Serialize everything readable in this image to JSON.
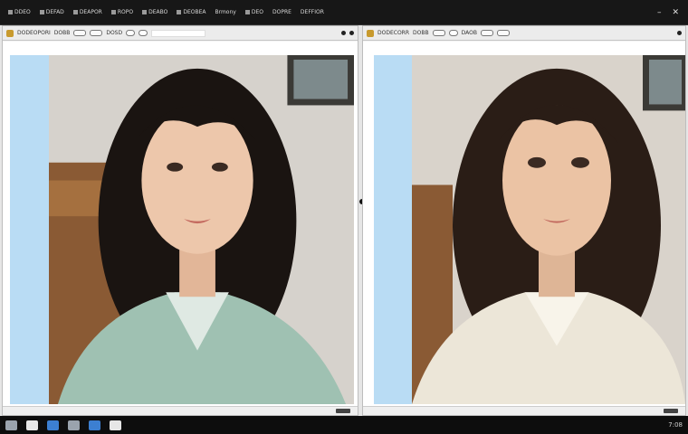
{
  "window": {
    "controls": [
      "–",
      "✕"
    ]
  },
  "menubar": {
    "items": [
      {
        "label": "DDEO",
        "icon": "file-icon"
      },
      {
        "label": "DEFAD",
        "icon": "edit-icon"
      },
      {
        "label": "DEAPOR",
        "icon": "view-icon"
      },
      {
        "label": "ROPO",
        "icon": "tools-icon"
      },
      {
        "label": "DEABO",
        "icon": "image-icon"
      },
      {
        "label": "DEOBEA",
        "icon": "window-icon"
      },
      {
        "label": "Brmony",
        "icon": "layers-icon"
      },
      {
        "label": "DEO",
        "icon": "filter-icon"
      },
      {
        "label": "DOPRE",
        "icon": "help-icon"
      },
      {
        "label": "DEFFIOR",
        "icon": "extras-icon"
      }
    ]
  },
  "panels": {
    "left": {
      "title": "DODEOPORI",
      "toolbar_labels": [
        "DOBB",
        "DOSD"
      ]
    },
    "right": {
      "title": "DODECORR",
      "toolbar_labels": [
        "DOBB",
        "DAOB"
      ]
    }
  },
  "colors": {
    "ruler": "#b9dcf4",
    "accent": "#c89a2e",
    "menubar": "#171717"
  },
  "taskbar": {
    "tray_text": "7:08"
  }
}
